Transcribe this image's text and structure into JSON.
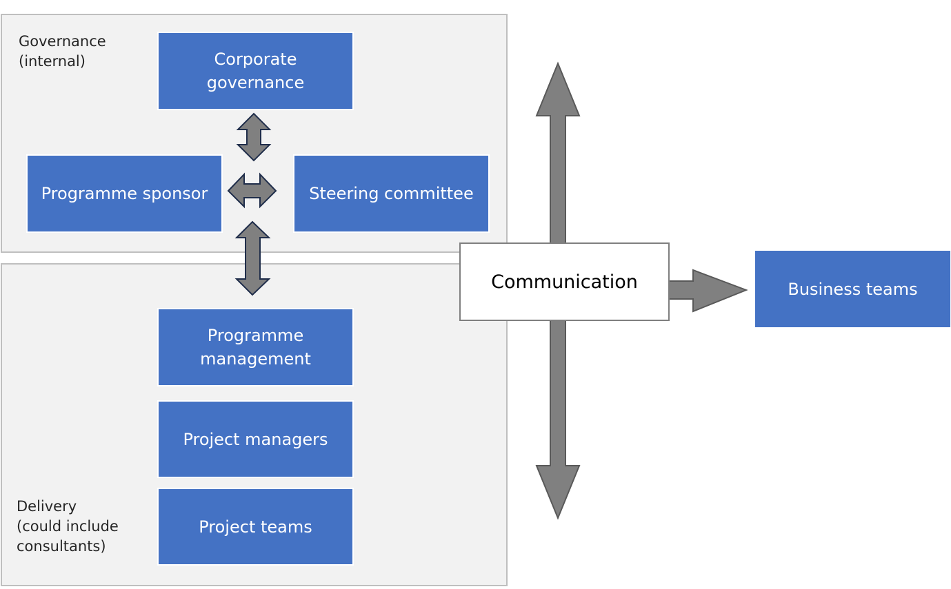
{
  "governance": {
    "label": "Governance\n(internal)"
  },
  "delivery": {
    "label": "Delivery\n(could include\nconsultants)"
  },
  "boxes": {
    "corporate_governance": "Corporate governance",
    "programme_sponsor": "Programme sponsor",
    "steering_committee": "Steering committee",
    "programme_management": "Programme management",
    "project_managers": "Project managers",
    "project_teams": "Project teams",
    "business_teams": "Business teams"
  },
  "communication": "Communication",
  "colors": {
    "box": "#4472c4",
    "panel": "#f2f2f2",
    "arrow": "#808080",
    "arrow_outline": "#1f2d4a"
  }
}
